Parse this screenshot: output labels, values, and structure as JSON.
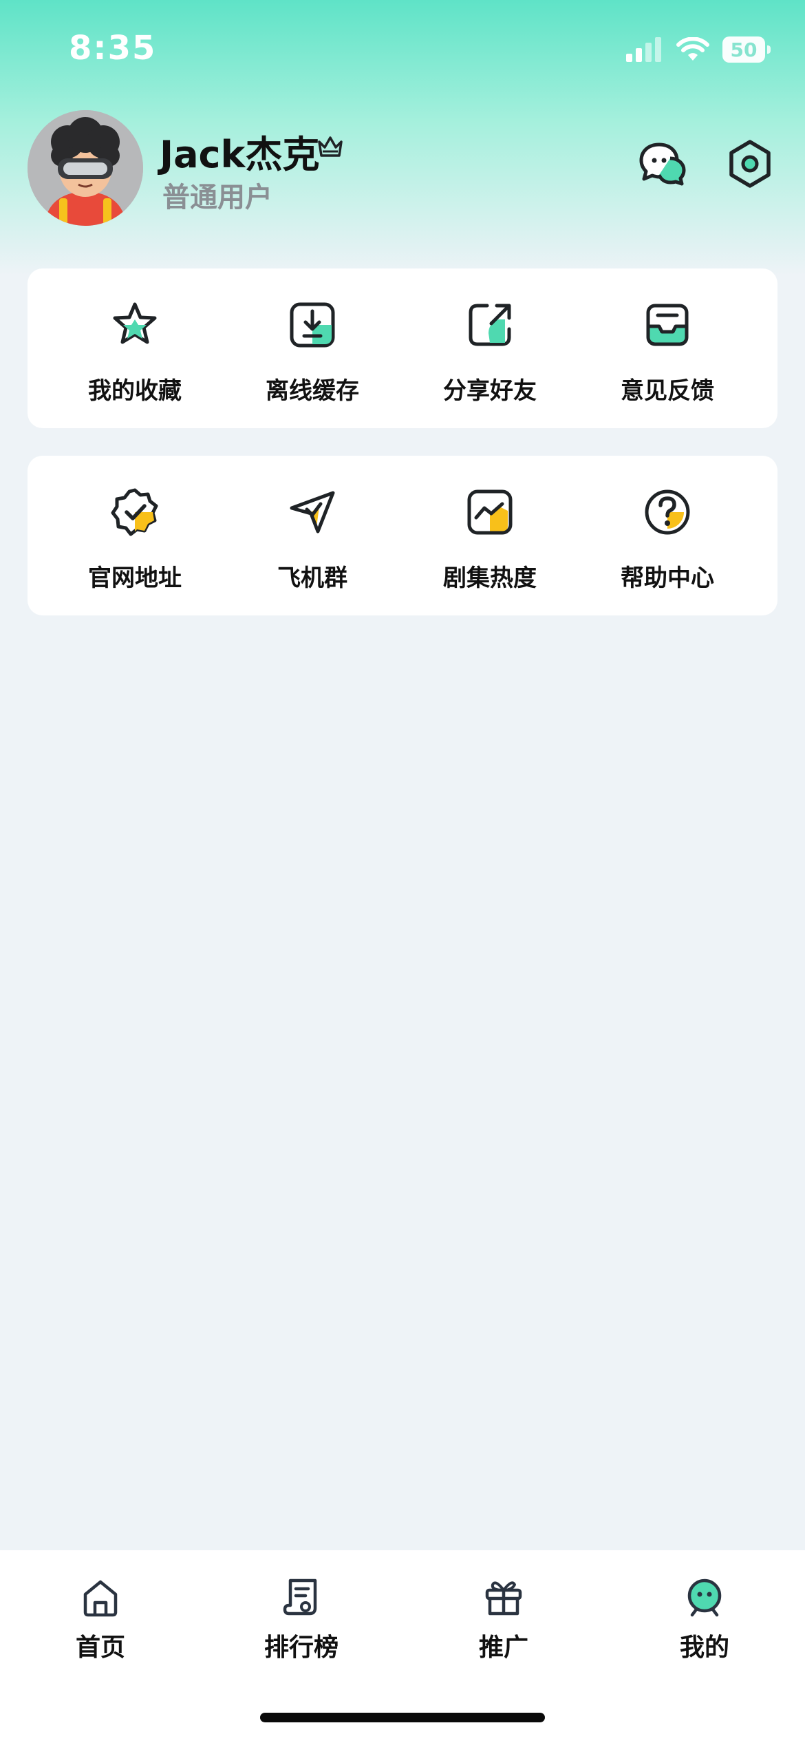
{
  "status_bar": {
    "time": "8:35",
    "battery": "50"
  },
  "profile": {
    "name": "Jack杰克",
    "level": "普通用户"
  },
  "quick_actions_1": [
    {
      "label": "我的收藏",
      "icon": "star-icon"
    },
    {
      "label": "离线缓存",
      "icon": "download-icon"
    },
    {
      "label": "分享好友",
      "icon": "share-icon"
    },
    {
      "label": "意见反馈",
      "icon": "inbox-icon"
    }
  ],
  "quick_actions_2": [
    {
      "label": "官网地址",
      "icon": "verified-badge-icon"
    },
    {
      "label": "飞机群",
      "icon": "paper-plane-icon"
    },
    {
      "label": "剧集热度",
      "icon": "trend-chart-icon"
    },
    {
      "label": "帮助中心",
      "icon": "help-icon"
    }
  ],
  "tabs": [
    {
      "label": "首页",
      "icon": "home-icon"
    },
    {
      "label": "排行榜",
      "icon": "ranking-scroll-icon"
    },
    {
      "label": "推广",
      "icon": "gift-icon"
    },
    {
      "label": "我的",
      "icon": "profile-face-icon",
      "active": true
    }
  ],
  "colors": {
    "accent_green": "#4fd9b0",
    "accent_yellow": "#f8c01a",
    "stroke": "#1f2326"
  }
}
